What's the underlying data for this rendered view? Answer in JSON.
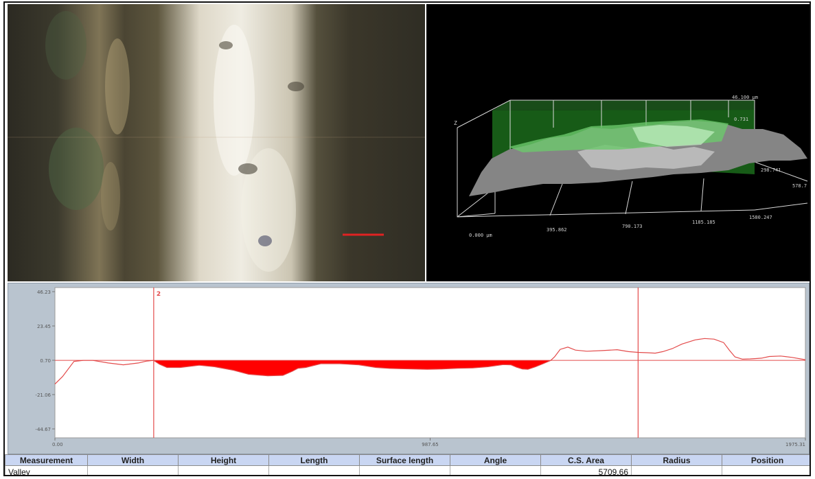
{
  "view3d": {
    "z_top_label": "46.100 µm",
    "z_plane_label": "0.731",
    "y_mid_label": "298.741",
    "y_end_label": "578.7",
    "x_start_label": "0.000 µm",
    "x_tick_labels": [
      "395.862",
      "790.173",
      "1185.185",
      "1580.247"
    ],
    "z_axis_label": "Z"
  },
  "chart_data": {
    "type": "line",
    "x_ticks": [
      "0.00",
      "987.65",
      "1975.31"
    ],
    "y_ticks": [
      "46.23",
      "23.45",
      "0.70",
      "-21.06",
      "-44.67"
    ],
    "xlim": [
      0,
      1975.31
    ],
    "ylim": [
      -44.67,
      46.23
    ],
    "reference_level": 0.7,
    "cursors": [
      {
        "x": 260,
        "label": "2"
      },
      {
        "x": 1535,
        "label": ""
      }
    ],
    "valley_range": [
      260,
      1315
    ],
    "series": [
      {
        "x": [
          0,
          20,
          50,
          75,
          100,
          140,
          180,
          220,
          240,
          260,
          275,
          295,
          330,
          380,
          420,
          470,
          510,
          560,
          600,
          625,
          640,
          660,
          700,
          750,
          800,
          845,
          880,
          910,
          940,
          980,
          1020,
          1060,
          1100,
          1140,
          1180,
          1200,
          1215,
          1230,
          1245,
          1265,
          1285,
          1305,
          1315,
          1330,
          1350,
          1370,
          1400,
          1440,
          1480,
          1510,
          1535,
          1560,
          1580,
          1600,
          1625,
          1650,
          1685,
          1710,
          1735,
          1760,
          1775,
          1790,
          1810,
          1830,
          1845,
          1860,
          1880,
          1910,
          1940,
          1975
        ],
        "y": [
          -15,
          -10,
          0,
          0.7,
          0.7,
          -1,
          -2.2,
          -1,
          0.2,
          0.7,
          -1.8,
          -4,
          -4,
          -2.5,
          -3.5,
          -5.8,
          -8.5,
          -9.5,
          -9.2,
          -6.5,
          -4.5,
          -4,
          -1.5,
          -1.5,
          -2.2,
          -4,
          -4.6,
          -4.8,
          -5,
          -5.2,
          -5,
          -4.5,
          -4.3,
          -3.5,
          -2.1,
          -2.2,
          -3.8,
          -5,
          -5.2,
          -3.5,
          -1.5,
          0.7,
          3,
          8,
          9.5,
          7.5,
          6.8,
          7.2,
          7.8,
          6.5,
          6,
          5.8,
          5.5,
          6.5,
          8.5,
          11.5,
          14.3,
          15.2,
          14.8,
          12.5,
          7.5,
          3,
          1.5,
          1.7,
          1.9,
          2.2,
          3.3,
          3.6,
          2.7,
          1.2
        ]
      }
    ]
  },
  "table": {
    "headers": [
      "Measurement",
      "Width",
      "Height",
      "Length",
      "Surface length",
      "Angle",
      "C.S. Area",
      "Radius",
      "Position"
    ],
    "rows": [
      [
        "Valley",
        "",
        "",
        "",
        "",
        "",
        "5709.66",
        "",
        ""
      ]
    ]
  }
}
